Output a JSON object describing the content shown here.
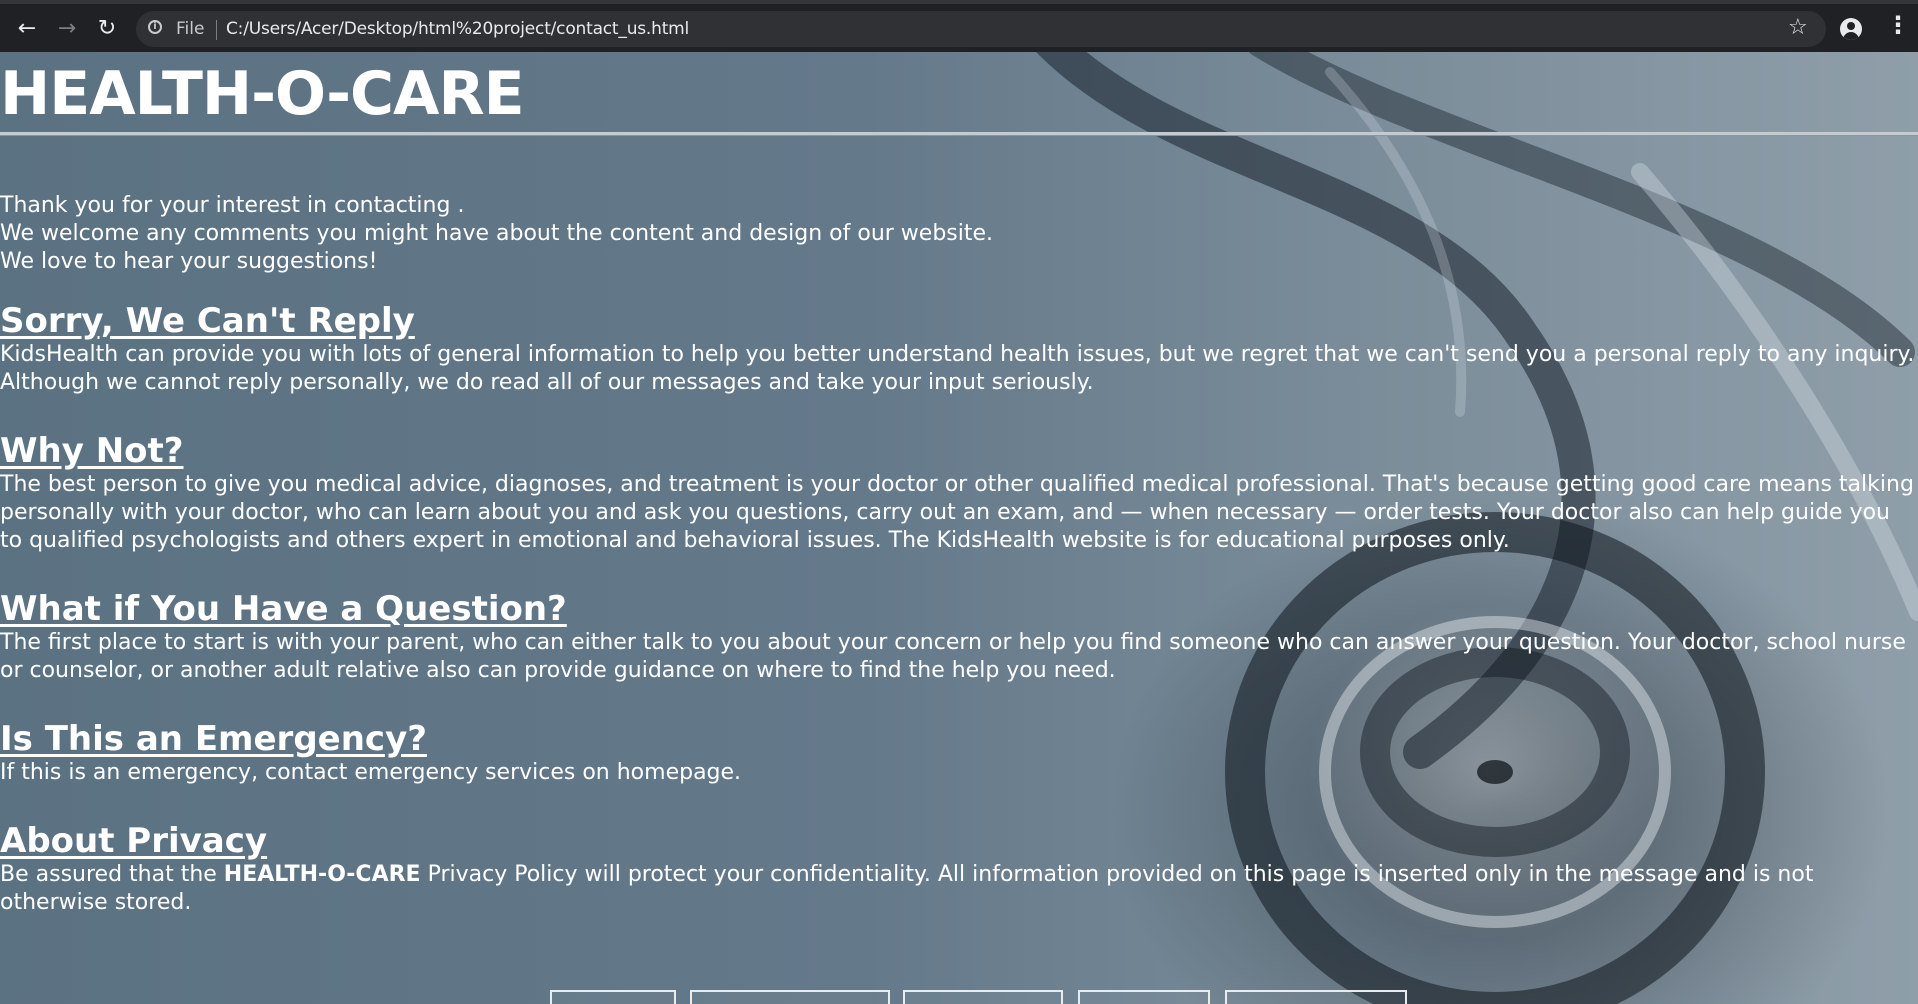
{
  "browser": {
    "back_icon": "back-arrow-icon",
    "forward_icon": "forward-arrow-icon",
    "reload_icon": "reload-icon",
    "scheme_label": "File",
    "url": "C:/Users/Acer/Desktop/html%20project/contact_us.html"
  },
  "page": {
    "site_title": "HEALTH-O-CARE",
    "intro": [
      "Thank you for your interest in contacting .",
      "We welcome any comments you might have about the content and design of our website.",
      "We love to hear your suggestions!"
    ],
    "sections": [
      {
        "heading": "Sorry, We Can't Reply",
        "body": "KidsHealth can provide you with lots of general information to help you better understand health issues, but we regret that we can't send you a personal reply to any inquiry. Although we cannot reply personally, we do read all of our messages and take your input seriously."
      },
      {
        "heading": "Why Not?",
        "body": "The best person to give you medical advice, diagnoses, and treatment is your doctor or other qualified medical professional. That's because getting good care means talking personally with your doctor, who can learn about you and ask you questions, carry out an exam, and — when necessary — order tests. Your doctor also can help guide you to qualified psychologists and others expert in emotional and behavioral issues. The KidsHealth website is for educational purposes only."
      },
      {
        "heading": "What if You Have a Question?",
        "body": "The first place to start is with your parent, who can either talk to you about your concern or help you find someone who can answer your question. Your doctor, school nurse or counselor, or another adult relative also can provide guidance on where to find the help you need."
      },
      {
        "heading": "Is This an Emergency?",
        "body": "If this is an emergency, contact emergency services on homepage."
      },
      {
        "heading": "About Privacy",
        "body_prefix": "Be assured that the ",
        "body_strong": "HEALTH-O-CARE",
        "body_suffix": " Privacy Policy will protect your confidentiality. All information provided on this page is inserted only in the message and is not otherwise stored."
      }
    ]
  },
  "colors": {
    "chrome_bg": "#202124",
    "omnibox_bg": "#303134",
    "page_text": "#ffffff",
    "load_bar": "#8ab4f8"
  }
}
